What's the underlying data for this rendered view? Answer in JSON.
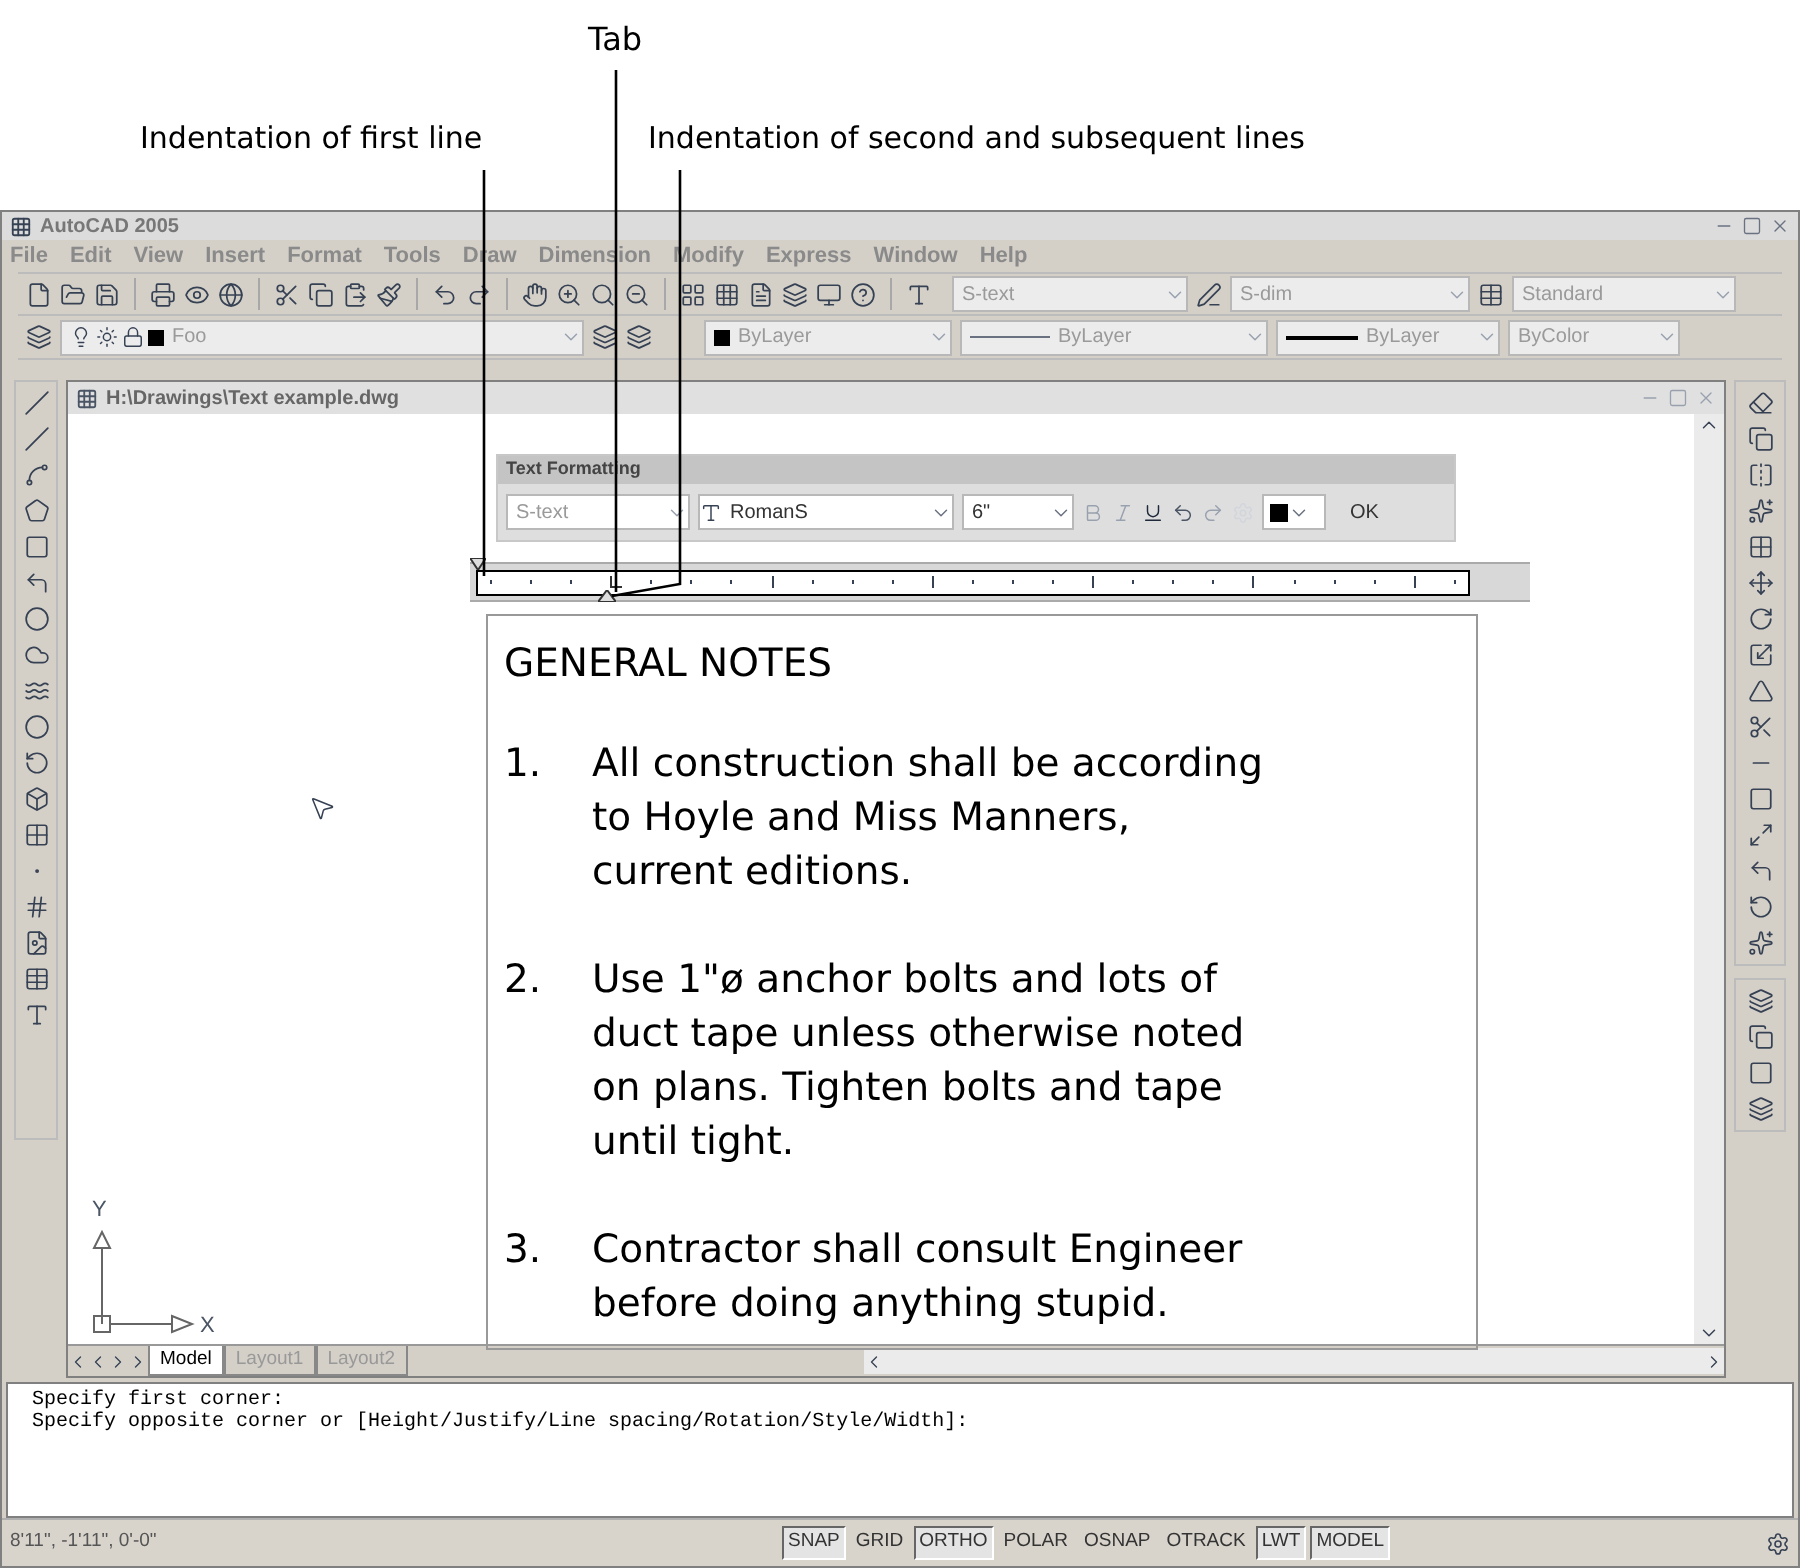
{
  "callouts": [
    {
      "label": "Tab"
    },
    {
      "label": "Indentation of first line"
    },
    {
      "label": "Indentation of second and subsequent lines"
    }
  ],
  "app": {
    "title": "AutoCAD 2005"
  },
  "menu": [
    "File",
    "Edit",
    "View",
    "Insert",
    "Format",
    "Tools",
    "Draw",
    "Dimension",
    "Modify",
    "Express",
    "Window",
    "Help"
  ],
  "toolbar_1_dropdowns": [
    {
      "value": "S-text"
    },
    {
      "value": "S-dim"
    },
    {
      "value": "Standard"
    }
  ],
  "toolbar_2_dropdowns": [
    {
      "kind": "layer",
      "value": "Foo"
    },
    {
      "kind": "color",
      "value": "ByLayer"
    },
    {
      "kind": "linetype",
      "value": "ByLayer"
    },
    {
      "kind": "lineweight",
      "value": "ByLayer"
    },
    {
      "kind": "plain",
      "value": "ByColor"
    }
  ],
  "drawing": {
    "title": "H:\\Drawings\\Text example.dwg"
  },
  "text_formatting": {
    "title": "Text Formatting",
    "style": "S-text",
    "font": "RomanS",
    "height": "6\"",
    "ok": "OK"
  },
  "notes": {
    "heading": "GENERAL NOTES",
    "items": [
      {
        "number": "1.",
        "lines": [
          "All construction shall be according",
          "to Hoyle and Miss Manners,",
          "current editions."
        ]
      },
      {
        "number": "2.",
        "lines": [
          "Use 1\"ø anchor bolts and lots of",
          "duct tape unless otherwise noted",
          "on plans. Tighten bolts and tape",
          "until tight."
        ]
      },
      {
        "number": "3.",
        "lines": [
          "Contractor shall consult Engineer",
          "before doing anything stupid."
        ]
      }
    ]
  },
  "ucs": {
    "y": "Y",
    "x": "X"
  },
  "layout_tabs": [
    {
      "label": "Model",
      "selected": true
    },
    {
      "label": "Layout1",
      "selected": false
    },
    {
      "label": "Layout2",
      "selected": false
    }
  ],
  "command_lines": [
    "Specify first corner:",
    "Specify opposite corner or [Height/Justify/Line spacing/Rotation/Style/Width]:"
  ],
  "status_bar": {
    "coordinates": "8'11\", -1'11\", 0'-0\"",
    "toggles": [
      {
        "label": "SNAP",
        "on": true
      },
      {
        "label": "GRID",
        "on": false
      },
      {
        "label": "ORTHO",
        "on": true
      },
      {
        "label": "POLAR",
        "on": false
      },
      {
        "label": "OSNAP",
        "on": false
      },
      {
        "label": "OTRACK",
        "on": false
      },
      {
        "label": "LWT",
        "on": true
      },
      {
        "label": "MODEL",
        "on": true
      }
    ]
  }
}
